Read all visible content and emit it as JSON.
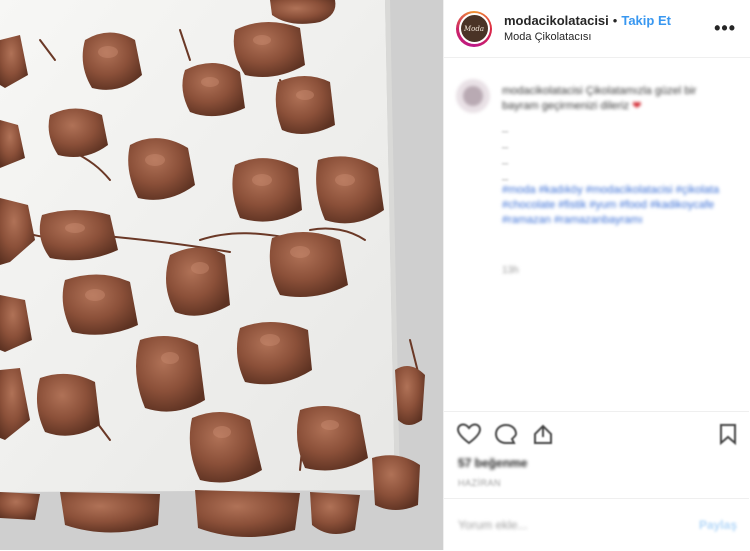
{
  "header": {
    "username": "modacikolatacisi",
    "separator": "•",
    "follow_label": "Takip Et",
    "location": "Moda Çikolatacısı",
    "more_glyph": "•••",
    "avatar_text": "Moda"
  },
  "caption": {
    "text": "modacikolatacisi Çikolatamızla güzel bir bayram geçirmenizi dileriz",
    "heart": "❤",
    "dashes": [
      "_",
      "_",
      "_",
      "_"
    ],
    "hashtags": "#moda #kadıköy #modacikolatacisi #çikolata #chocolate #fistik #yum #food #kadikoycafe #ramazan #ramazanbayramı",
    "time_ago": "13h"
  },
  "actions": {
    "likes": "57 beğenme",
    "date": "HAZİRAN",
    "icons": [
      "heart-icon",
      "comment-icon",
      "share-icon",
      "bookmark-icon"
    ]
  },
  "comment_box": {
    "placeholder": "Yorum ekle...",
    "post_label": "Paylaş"
  },
  "colors": {
    "follow": "#3897f0",
    "chocolate": "#8a4f39",
    "parchment": "#efefef"
  }
}
